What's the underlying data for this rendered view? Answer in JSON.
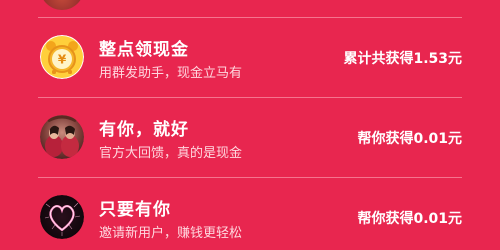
{
  "list": {
    "items": [
      {
        "title": "整点领现金",
        "subtitle": "用群发助手，现金立马有",
        "reward": "累计共获得1.53元",
        "icon": "alarm-clock-coin-icon",
        "icon_symbol": "¥"
      },
      {
        "title": "有你，就好",
        "subtitle": "官方大回馈，真的是现金",
        "reward": "帮你获得0.01元",
        "icon": "couple-photo-avatar"
      },
      {
        "title": "只要有你",
        "subtitle": "邀请新用户，赚钱更轻松",
        "reward": "帮你获得0.01元",
        "icon": "sparkler-heart-avatar"
      }
    ]
  },
  "colors": {
    "background": "#e8264f",
    "divider": "#f59aaa",
    "title": "#ffffff",
    "subtitle": "#ffd7df",
    "reward": "#ffffff",
    "clock_yellow": "#ffd23a"
  }
}
